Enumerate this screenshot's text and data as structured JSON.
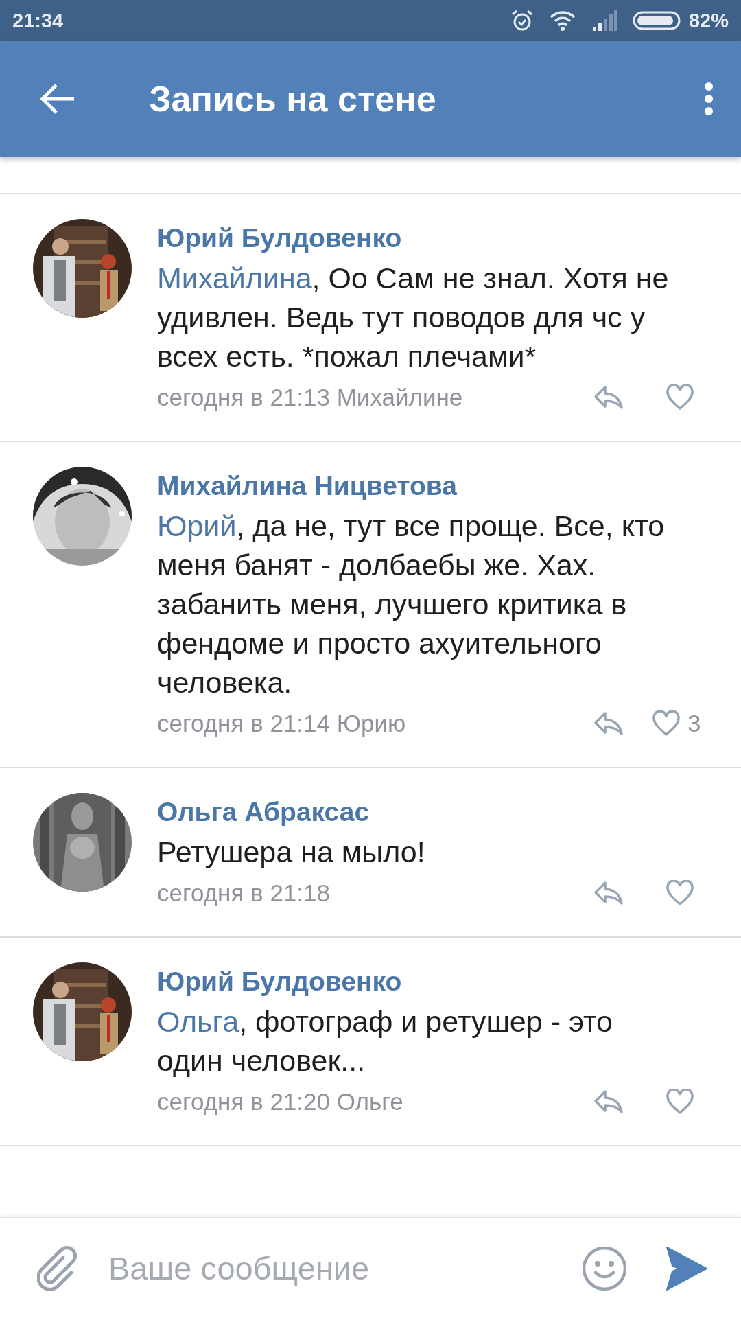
{
  "status_bar": {
    "time": "21:34",
    "battery": "82%"
  },
  "header": {
    "title": "Запись на стене"
  },
  "comments": [
    {
      "author": "Юрий Булдовенко",
      "mention": "Михайлина",
      "text": ", Оо Сам не знал. Хотя не удивлен. Ведь тут поводов для чс у всех есть. *пожал плечами*",
      "meta": "сегодня в 21:13 Михайлине"
    },
    {
      "author": "Михайлина Ницветова",
      "mention": "Юрий",
      "text": ", да не, тут все проще. Все, кто меня банят - долбаебы же. Хах. забанить меня, лучшего критика в фендоме и просто ахуительного человека.",
      "meta": "сегодня в 21:14 Юрию",
      "likes": "3"
    },
    {
      "author": "Ольга Абраксас",
      "text": "Ретушера на мыло!",
      "meta": "сегодня в 21:18"
    },
    {
      "author": "Юрий Булдовенко",
      "mention": "Ольга",
      "text": ", фотограф и ретушер - это один человек...",
      "meta": "сегодня в 21:20 Ольге"
    }
  ],
  "composer": {
    "placeholder": "Ваше сообщение"
  }
}
